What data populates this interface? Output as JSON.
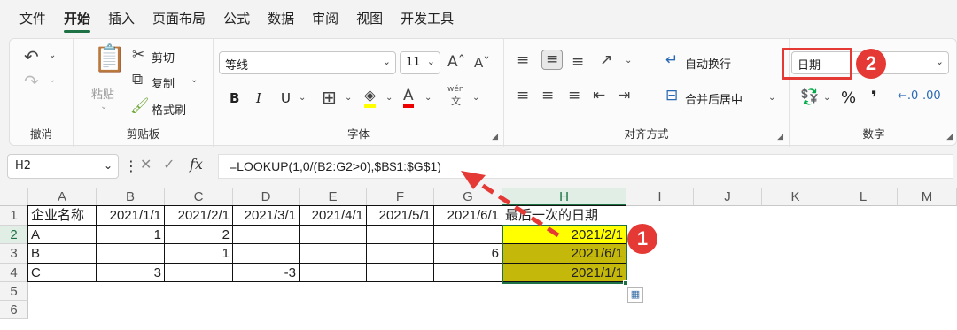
{
  "menu": {
    "items": [
      "文件",
      "开始",
      "插入",
      "页面布局",
      "公式",
      "数据",
      "审阅",
      "视图",
      "开发工具"
    ],
    "active_index": 1
  },
  "ribbon": {
    "undo_group": {
      "label": "撤消"
    },
    "clipboard": {
      "label": "剪贴板",
      "paste": "粘贴",
      "cut": "剪切",
      "copy": "复制",
      "format_painter": "格式刷"
    },
    "font": {
      "label": "字体",
      "name": "等线",
      "size": "11",
      "bold": "B",
      "italic": "I",
      "underline": "U",
      "wen": "wén",
      "wen_char": "文"
    },
    "alignment": {
      "label": "对齐方式",
      "wrap_text": "自动换行",
      "merge_center": "合并后居中"
    },
    "number": {
      "label": "数字",
      "format": "日期",
      "percent": "%",
      "comma": "❜"
    }
  },
  "formula_bar": {
    "name_box": "H2",
    "fx": "fx",
    "formula": "=LOOKUP(1,0/(B2:G2>0),$B$1:$G$1)"
  },
  "sheet": {
    "columns": [
      "A",
      "B",
      "C",
      "D",
      "E",
      "F",
      "G",
      "H",
      "I",
      "J",
      "K",
      "L",
      "M"
    ],
    "rows": [
      "1",
      "2",
      "3",
      "4",
      "5",
      "6"
    ],
    "cells": {
      "header": [
        "企业名称",
        "2021/1/1",
        "2021/2/1",
        "2021/3/1",
        "2021/4/1",
        "2021/5/1",
        "2021/6/1",
        "最后一次的日期"
      ],
      "r2": [
        "A",
        "1",
        "2",
        "",
        "",
        "",
        "",
        "2021/2/1"
      ],
      "r3": [
        "B",
        "",
        "1",
        "",
        "",
        "",
        "6",
        "2021/6/1"
      ],
      "r4": [
        "C",
        "3",
        "",
        "-3",
        "",
        "",
        "",
        "2021/1/1"
      ]
    },
    "selected_cell": "H2"
  },
  "annotations": {
    "badge1": "1",
    "badge2": "2"
  },
  "colors": {
    "accent": "#1e7145",
    "highlight_yellow": "#ffff00",
    "highlight_olive": "#c4b80a",
    "annotation_red": "#e53935"
  }
}
